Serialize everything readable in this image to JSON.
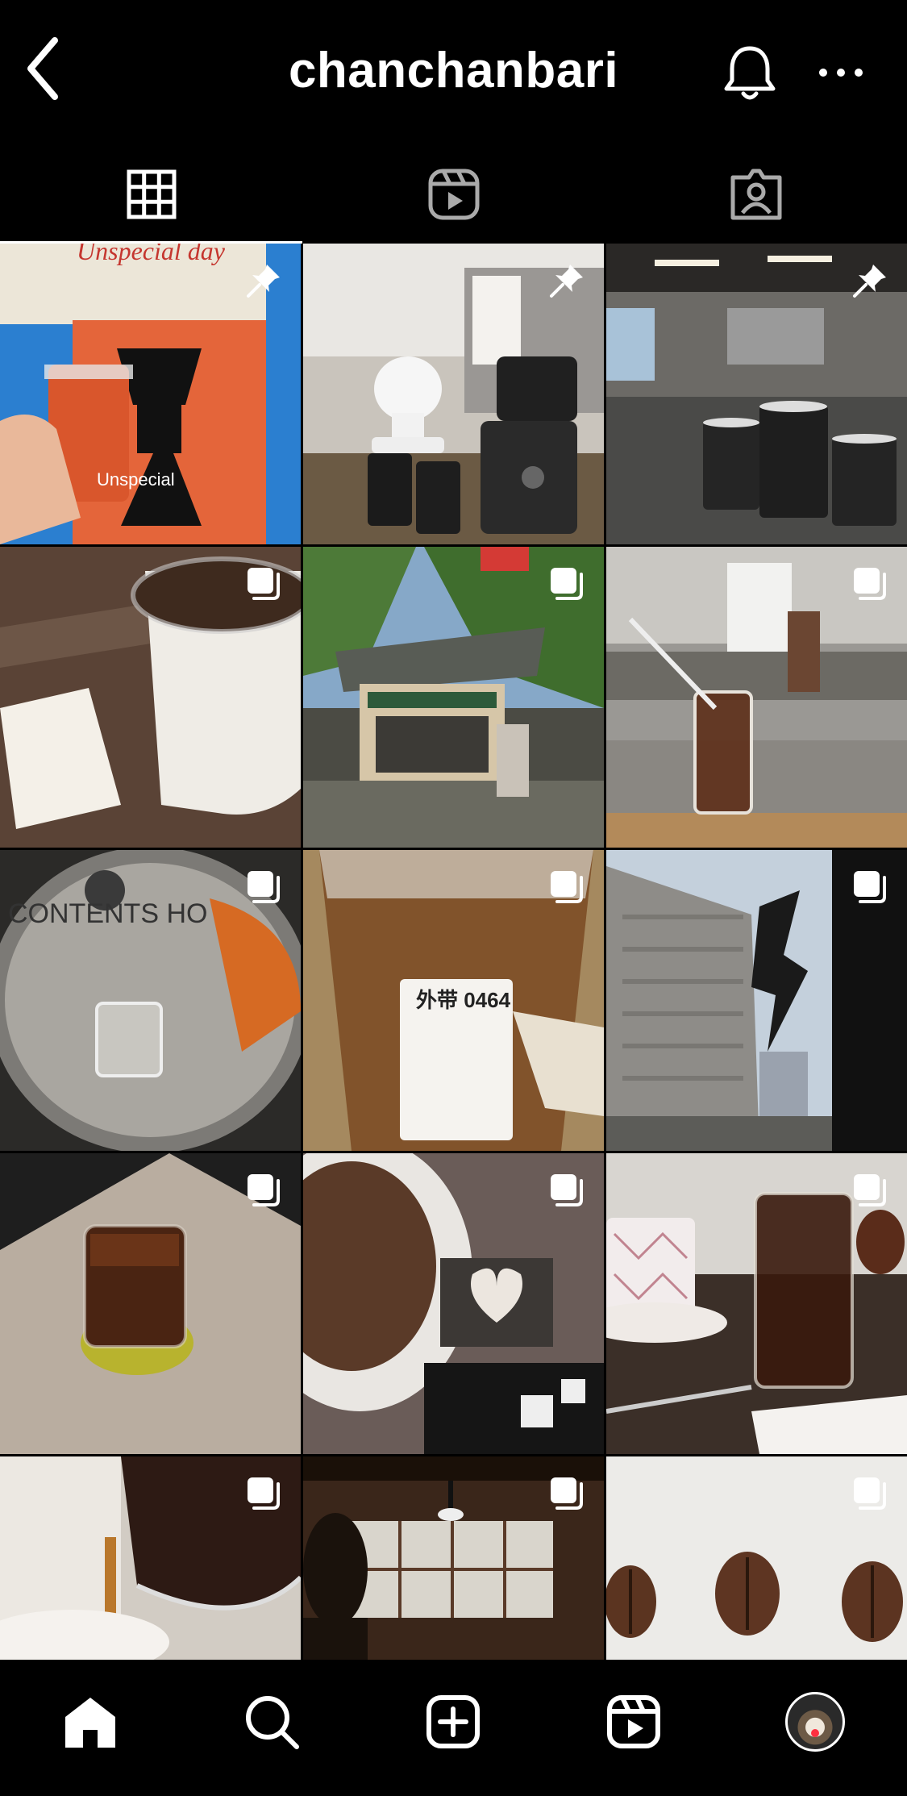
{
  "header": {
    "username": "chanchanbari",
    "back_icon": "chevron-left-icon",
    "bell_icon": "bell-icon",
    "more_icon": "more-horizontal-icon"
  },
  "tabs": [
    {
      "name": "posts-grid",
      "icon": "grid-icon",
      "active": true
    },
    {
      "name": "reels",
      "icon": "reels-icon",
      "active": false
    },
    {
      "name": "tagged",
      "icon": "tagged-person-icon",
      "active": false
    }
  ],
  "posts": [
    {
      "id": "post-1",
      "badge": "pin-icon",
      "caption_text": "Unspecial day",
      "subject": "orange coffee cup held against poster"
    },
    {
      "id": "post-2",
      "badge": "pin-icon",
      "subject": "coffee brewing equipment on counter"
    },
    {
      "id": "post-3",
      "badge": "pin-icon",
      "subject": "three cups in cafe interior"
    },
    {
      "id": "post-4",
      "badge": "multi-post-icon",
      "subject": "iced coffee cup and receipt"
    },
    {
      "id": "post-5",
      "badge": "multi-post-icon",
      "subject": "outdoor coffee kiosk with palm trees"
    },
    {
      "id": "post-6",
      "badge": "multi-post-icon",
      "subject": "iced coffee with straw in cafe"
    },
    {
      "id": "post-7",
      "badge": "multi-post-icon",
      "caption_text": "CONTENTS HO",
      "subject": "close-up of plastic cup lid"
    },
    {
      "id": "post-8",
      "badge": "multi-post-icon",
      "caption_text": "外带 0464",
      "subject": "iced drink with label sticker"
    },
    {
      "id": "post-9",
      "badge": "multi-post-icon",
      "subject": "city buildings from cafe window"
    },
    {
      "id": "post-10",
      "badge": "multi-post-icon",
      "subject": "iced coffee glass on stone coaster"
    },
    {
      "id": "post-11",
      "badge": "multi-post-icon",
      "subject": "paper filter and heart-shaped package"
    },
    {
      "id": "post-12",
      "badge": "multi-post-icon",
      "subject": "coffee carafe, cup and chocolate cake"
    },
    {
      "id": "post-13",
      "badge": "multi-post-icon",
      "subject": "pouring coffee from carafe"
    },
    {
      "id": "post-14",
      "badge": "multi-post-icon",
      "subject": "dark cafe interior with window"
    },
    {
      "id": "post-15",
      "badge": "multi-post-icon",
      "subject": "coffee beans on white surface"
    }
  ],
  "bottom_nav": [
    {
      "name": "home",
      "icon": "home-icon",
      "active": true
    },
    {
      "name": "search",
      "icon": "search-icon",
      "active": false
    },
    {
      "name": "create",
      "icon": "plus-square-icon",
      "active": false
    },
    {
      "name": "reels",
      "icon": "reels-icon",
      "active": false
    },
    {
      "name": "profile",
      "icon": "profile-avatar-icon",
      "active": false,
      "notification_dot": true
    }
  ],
  "colors": {
    "background": "#000000",
    "foreground": "#ffffff",
    "notification": "#ff3040"
  }
}
